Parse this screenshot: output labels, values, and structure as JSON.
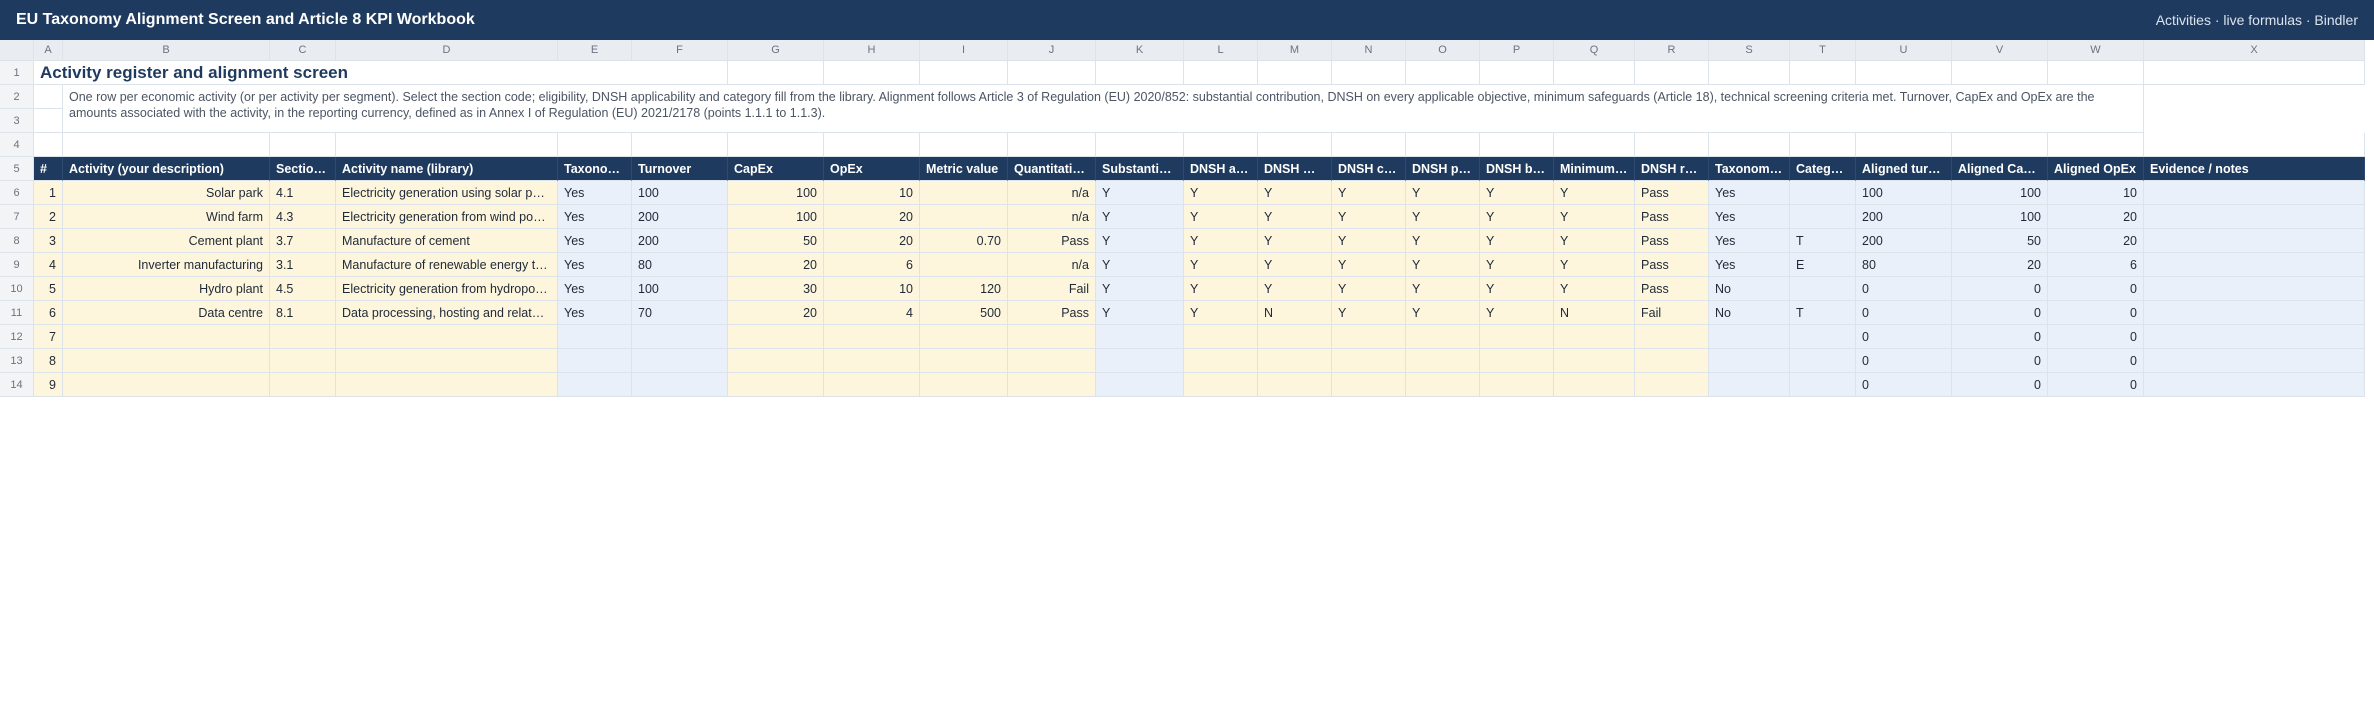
{
  "titlebar": {
    "title": "EU Taxonomy Alignment Screen and Article 8 KPI Workbook",
    "meta": "Activities · live formulas · Bindler"
  },
  "columns": [
    "A",
    "B",
    "C",
    "D",
    "E",
    "F",
    "G",
    "H",
    "I",
    "J",
    "K",
    "L",
    "M",
    "N",
    "O",
    "P",
    "Q",
    "R",
    "S",
    "T",
    "U",
    "V",
    "W",
    "X"
  ],
  "row_numbers": [
    "1",
    "2",
    "3",
    "4",
    "5",
    "6",
    "7",
    "8",
    "9",
    "10",
    "11",
    "12",
    "13",
    "14"
  ],
  "sheet": {
    "title": "Activity register and alignment screen",
    "description": "One row per economic activity (or per activity per segment). Select the section code; eligibility, DNSH applicability and category fill from the library. Alignment follows Article 3 of Regulation (EU) 2020/852: substantial contribution, DNSH on every applicable objective, minimum safeguards (Article 18), technical screening criteria met. Turnover, CapEx and OpEx are the amounts associated with the activity, in the reporting currency, defined as in Annex I of Regulation (EU) 2021/2178 (points 1.1.1 to 1.1.3)."
  },
  "table": {
    "headers": [
      "#",
      "Activity (your description)",
      "Section code",
      "Activity name (library)",
      "Taxonomy-eligible",
      "Turnover",
      "CapEx",
      "OpEx",
      "Metric value",
      "Quantitative test",
      "Substantial contribution",
      "DNSH adaptation",
      "DNSH water",
      "DNSH circular",
      "DNSH pollution",
      "DNSH biodiversity",
      "Minimum safeguards",
      "DNSH result",
      "Taxonomy-aligned",
      "Category",
      "Aligned turnover",
      "Aligned CapEx",
      "Aligned OpEx",
      "Evidence / notes"
    ],
    "rows": [
      [
        "1",
        "Solar park",
        "4.1",
        "Electricity generation using solar photovoltaic technology",
        "Yes",
        "100",
        "100",
        "10",
        "",
        "n/a",
        "Y",
        "Y",
        "Y",
        "Y",
        "Y",
        "Y",
        "Y",
        "Pass",
        "Yes",
        "",
        "100",
        "100",
        "10",
        ""
      ],
      [
        "2",
        "Wind farm",
        "4.3",
        "Electricity generation from wind power",
        "Yes",
        "200",
        "100",
        "20",
        "",
        "n/a",
        "Y",
        "Y",
        "Y",
        "Y",
        "Y",
        "Y",
        "Y",
        "Pass",
        "Yes",
        "",
        "200",
        "100",
        "20",
        ""
      ],
      [
        "3",
        "Cement plant",
        "3.7",
        "Manufacture of cement",
        "Yes",
        "200",
        "50",
        "20",
        "0.70",
        "Pass",
        "Y",
        "Y",
        "Y",
        "Y",
        "Y",
        "Y",
        "Y",
        "Pass",
        "Yes",
        "T",
        "200",
        "50",
        "20",
        ""
      ],
      [
        "4",
        "Inverter manufacturing",
        "3.1",
        "Manufacture of renewable energy technologies",
        "Yes",
        "80",
        "20",
        "6",
        "",
        "n/a",
        "Y",
        "Y",
        "Y",
        "Y",
        "Y",
        "Y",
        "Y",
        "Pass",
        "Yes",
        "E",
        "80",
        "20",
        "6",
        ""
      ],
      [
        "5",
        "Hydro plant",
        "4.5",
        "Electricity generation from hydropower",
        "Yes",
        "100",
        "30",
        "10",
        "120",
        "Fail",
        "Y",
        "Y",
        "Y",
        "Y",
        "Y",
        "Y",
        "Y",
        "Pass",
        "No",
        "",
        "0",
        "0",
        "0",
        ""
      ],
      [
        "6",
        "Data centre",
        "8.1",
        "Data processing, hosting and related activities",
        "Yes",
        "70",
        "20",
        "4",
        "500",
        "Pass",
        "Y",
        "Y",
        "N",
        "Y",
        "Y",
        "Y",
        "N",
        "Fail",
        "No",
        "T",
        "0",
        "0",
        "0",
        ""
      ],
      [
        "7",
        "",
        "",
        "",
        "",
        "",
        "",
        "",
        "",
        "",
        "",
        "",
        "",
        "",
        "",
        "",
        "",
        "",
        "",
        "",
        "0",
        "0",
        "0",
        ""
      ],
      [
        "8",
        "",
        "",
        "",
        "",
        "",
        "",
        "",
        "",
        "",
        "",
        "",
        "",
        "",
        "",
        "",
        "",
        "",
        "",
        "",
        "0",
        "0",
        "0",
        ""
      ],
      [
        "9",
        "",
        "",
        "",
        "",
        "",
        "",
        "",
        "",
        "",
        "",
        "",
        "",
        "",
        "",
        "",
        "",
        "",
        "",
        "",
        "0",
        "0",
        "0",
        ""
      ]
    ]
  }
}
